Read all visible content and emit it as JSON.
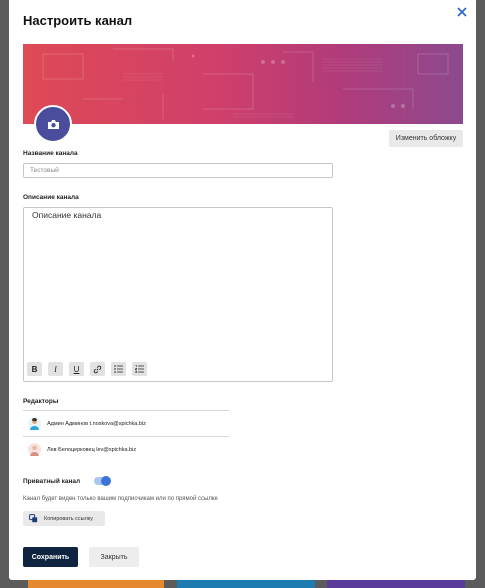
{
  "dialog": {
    "title": "Настроить канал",
    "close_icon": "close-icon"
  },
  "cover": {
    "change_button_label": "Изменить обложку",
    "colors": [
      "#de4a55",
      "#cf3f6b",
      "#b13b7a",
      "#8c4a8e"
    ],
    "avatar_icon": "camera-icon",
    "avatar_color": "#4a4d9c"
  },
  "channel_name": {
    "label": "Название канала",
    "placeholder": "Тестовый"
  },
  "description": {
    "label": "Описание канала",
    "value": "Описание канала",
    "toolbar": [
      {
        "name": "bold-button",
        "glyph": "B"
      },
      {
        "name": "italic-button",
        "glyph": "I"
      },
      {
        "name": "underline-button",
        "glyph": "U"
      },
      {
        "name": "link-button",
        "icon": "link-icon"
      },
      {
        "name": "bullet-list-button",
        "icon": "bullet-list-icon"
      },
      {
        "name": "numbered-list-button",
        "icon": "numbered-list-icon"
      }
    ]
  },
  "editors": {
    "label": "Редакторы",
    "items": [
      {
        "name": "Админ Админов t.noskova@spichka.biz",
        "avatar_color": "#2aa7d9"
      },
      {
        "name": "Лев Белоцерковец lev@spichka.biz",
        "avatar_color": "#f0c9c0"
      }
    ]
  },
  "privacy": {
    "label": "Приватный канал",
    "enabled": true,
    "hint": "Канал будет виден только вашим подписчикам или по прямой ссылке",
    "copy_link_label": "Копировать ссылку",
    "accent": "#3b73d6"
  },
  "footer": {
    "save_label": "Сохранить",
    "close_label": "Закрыть",
    "save_color": "#0f2440"
  }
}
